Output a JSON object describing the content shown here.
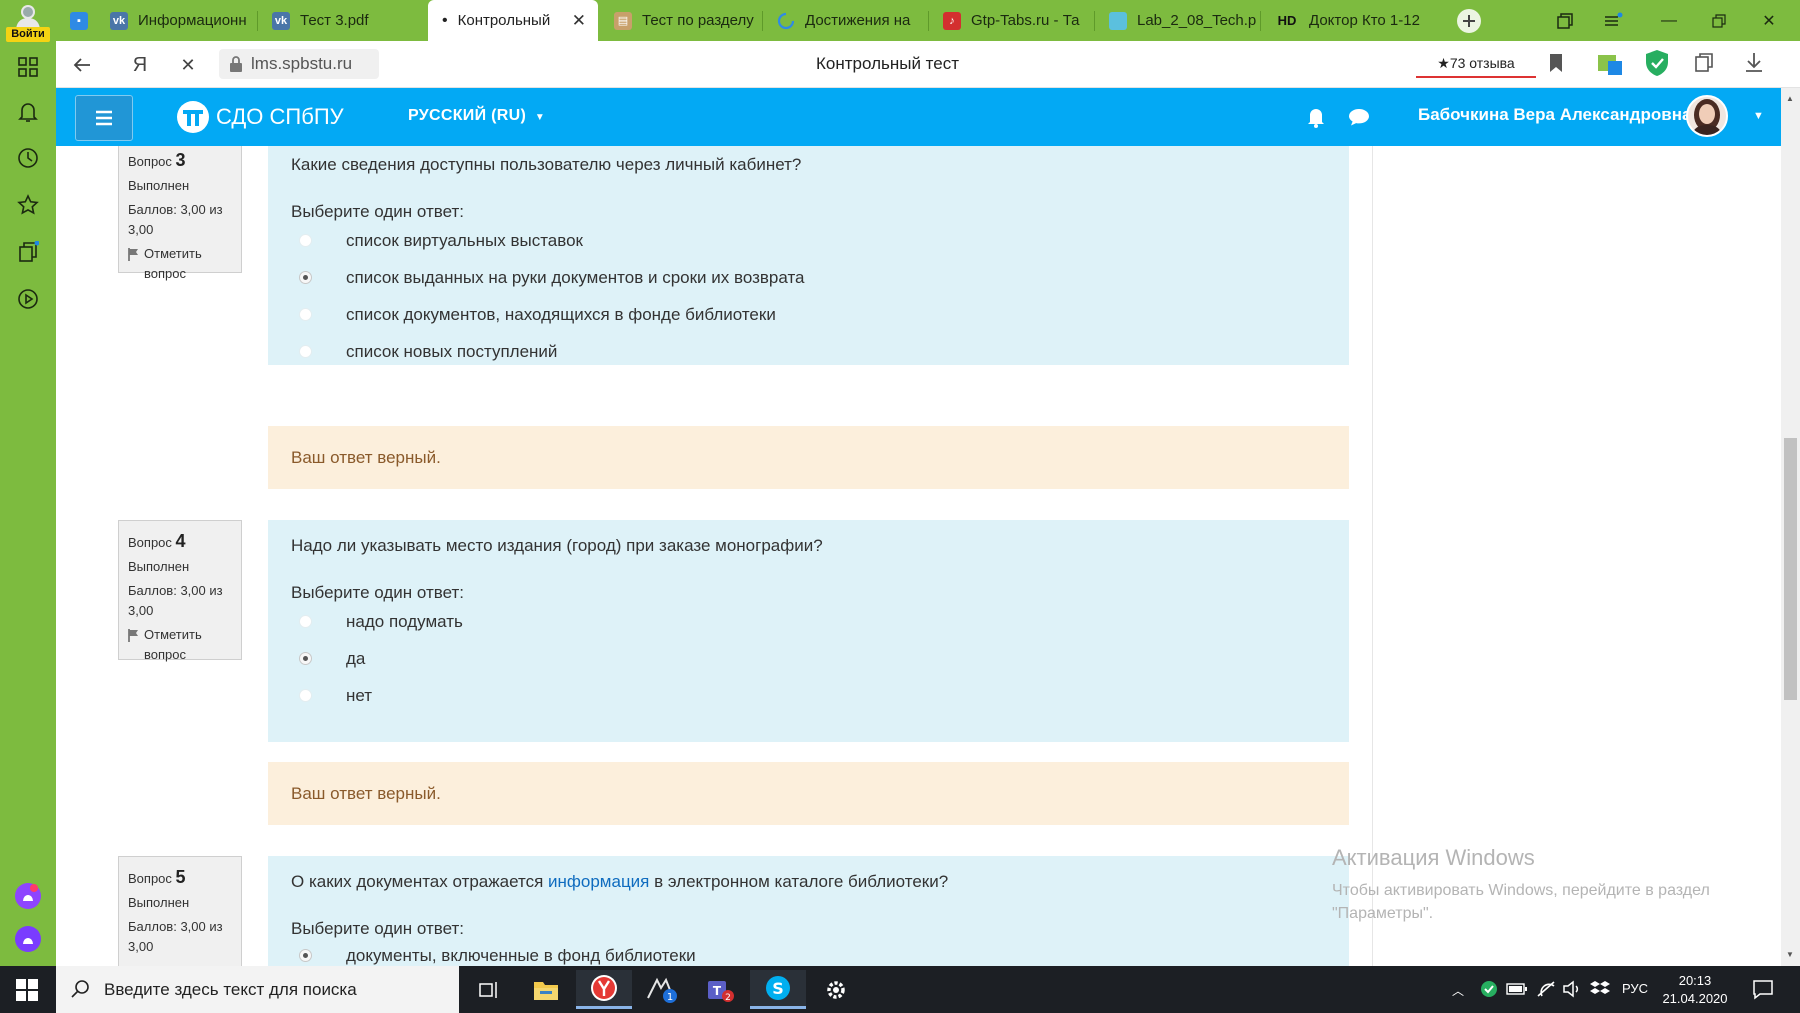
{
  "browser": {
    "login_label": "Войти",
    "tabs": [
      {
        "title": "",
        "icon": "chat-icon",
        "color": "#2f8ae5"
      },
      {
        "title": "Информационн",
        "icon": "vk-icon",
        "color": "#4a76a8"
      },
      {
        "title": "Тест 3.pdf",
        "icon": "vk-icon",
        "color": "#4a76a8"
      },
      {
        "title": "Контрольный",
        "icon": "dot-icon",
        "active": true
      },
      {
        "title": "Тест по разделу",
        "icon": "book-icon",
        "color": "#8a6d3b"
      },
      {
        "title": "Достижения на",
        "icon": "loading-icon",
        "color": "#2f8ae5"
      },
      {
        "title": "Gtp-Tabs.ru - Та",
        "icon": "guitar-icon",
        "color": "#d32f2f"
      },
      {
        "title": "Lab_2_08_Tech.p",
        "icon": "doc-icon",
        "color": "#5bc0de"
      },
      {
        "title": "Доктор Кто 1-12",
        "icon": "hd-icon",
        "badge": "HD"
      }
    ],
    "url": "lms.spbstu.ru",
    "page_title": "Контрольный тест",
    "reviews": "★73 отзыва"
  },
  "header": {
    "site_name": "СДО СПбПУ",
    "language": "РУССКИЙ (RU)",
    "user_name": "Бабочкина Вера Александровна"
  },
  "questions": [
    {
      "label": "Вопрос",
      "number": "3",
      "status": "Выполнен",
      "score": "Баллов: 3,00 из 3,00",
      "flag": "Отметить вопрос",
      "text_before": "Какие сведения доступны пользователю через личный кабинет?",
      "link": "",
      "text_after": "",
      "prompt": "Выберите один ответ:",
      "options": [
        {
          "text": "список виртуальных выставок",
          "selected": false
        },
        {
          "text": "список  выданных на руки документов и сроки их возврата",
          "selected": true
        },
        {
          "text": "список документов, находящихся в фонде библиотеки",
          "selected": false
        },
        {
          "text": "список новых поступлений",
          "selected": false
        }
      ],
      "feedback": "Ваш ответ верный."
    },
    {
      "label": "Вопрос",
      "number": "4",
      "status": "Выполнен",
      "score": "Баллов: 3,00 из 3,00",
      "flag": "Отметить вопрос",
      "text_before": "Надо ли указывать место издания (город) при заказе монографии?",
      "link": "",
      "text_after": "",
      "prompt": "Выберите один ответ:",
      "options": [
        {
          "text": "надо подумать",
          "selected": false
        },
        {
          "text": "да",
          "selected": true
        },
        {
          "text": "нет",
          "selected": false
        }
      ],
      "feedback": "Ваш ответ верный."
    },
    {
      "label": "Вопрос",
      "number": "5",
      "status": "Выполнен",
      "score": "Баллов: 3,00 из 3,00",
      "flag": "",
      "text_before": "О каких документах отражается ",
      "link": "информация",
      "text_after": " в электронном каталоге библиотеки?",
      "prompt": "Выберите один ответ:",
      "options": [
        {
          "text": "документы, включенные в фонд библиотеки",
          "selected": true
        }
      ],
      "feedback": ""
    }
  ],
  "watermark": {
    "title": "Активация Windows",
    "line1": "Чтобы активировать Windows, перейдите в раздел",
    "line2": "\"Параметры\"."
  },
  "taskbar": {
    "search_placeholder": "Введите здесь текст для поиска",
    "language": "РУС",
    "time": "20:13",
    "date": "21.04.2020"
  },
  "colors": {
    "browser_green": "#7dbb3f",
    "lms_blue": "#03a9f4",
    "question_bg": "#def2f8",
    "feedback_bg": "#fcefdc"
  }
}
